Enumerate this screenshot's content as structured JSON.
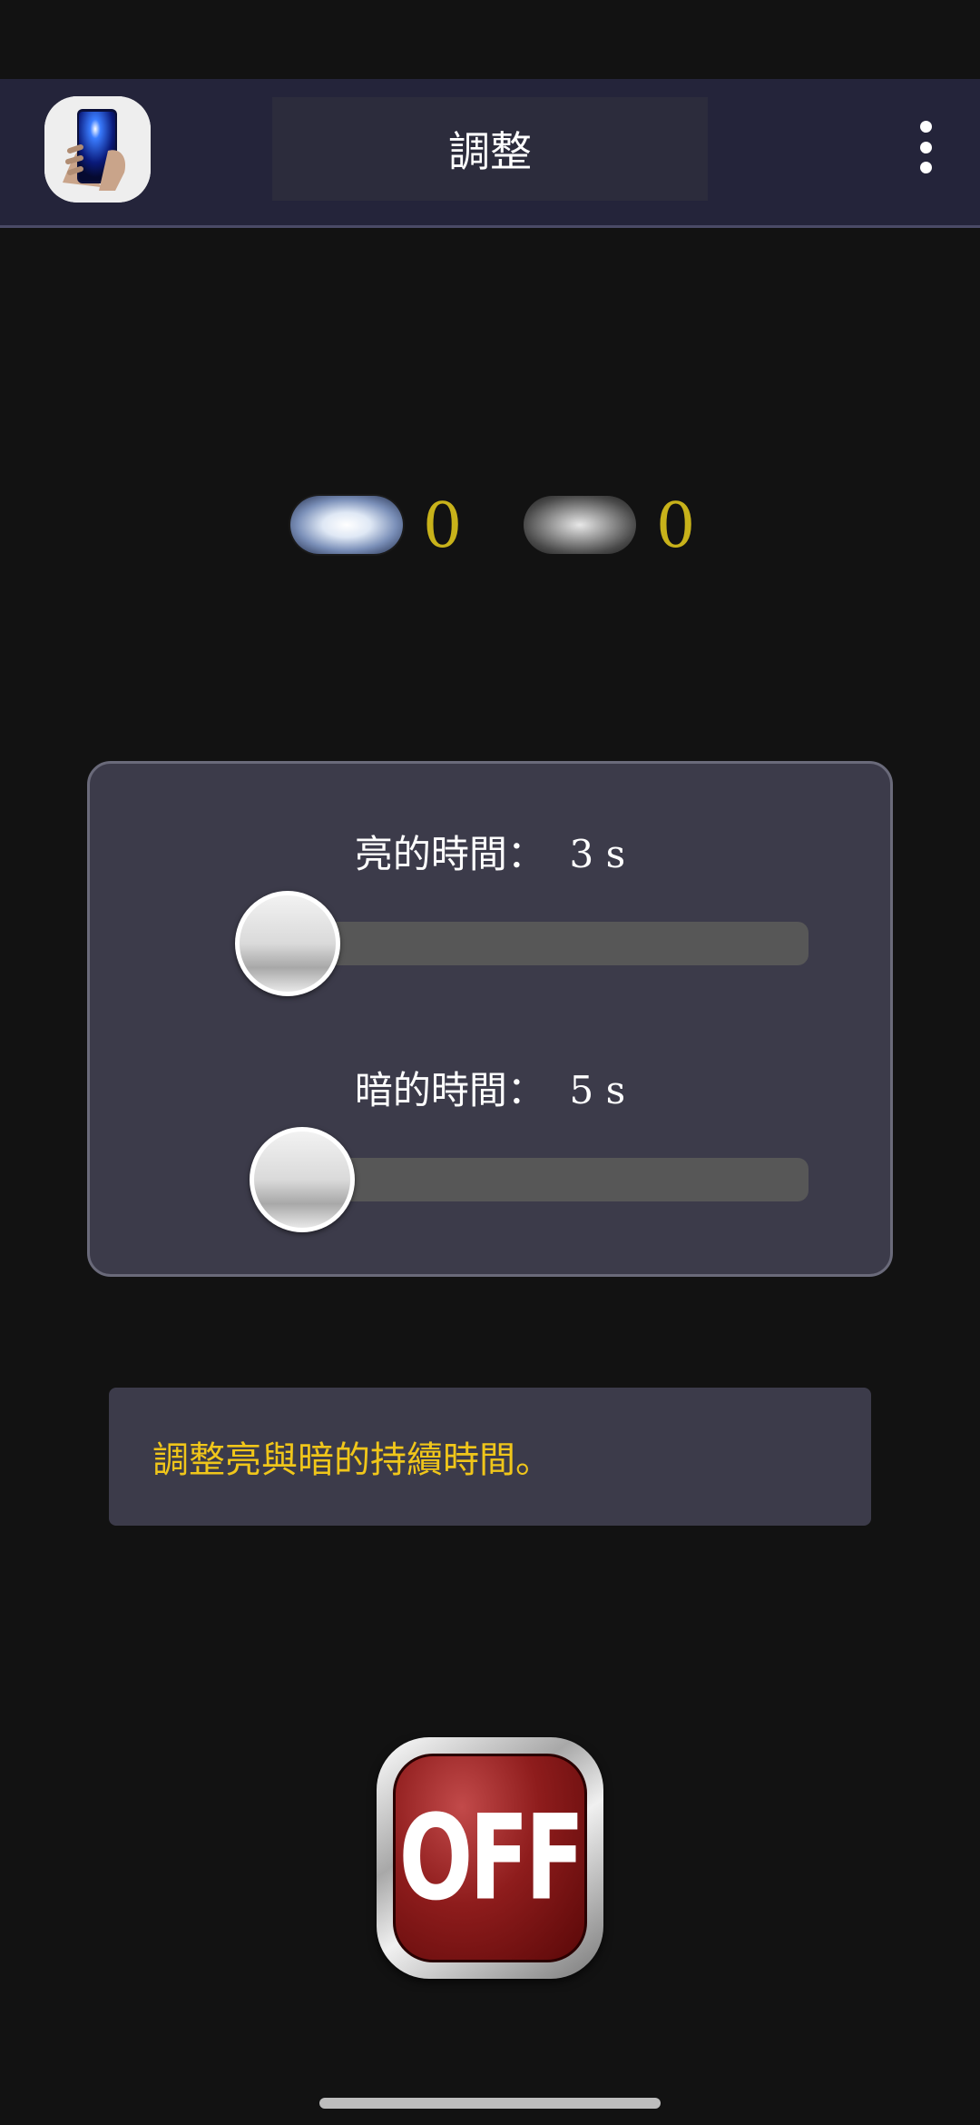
{
  "app_bar": {
    "title": "調整",
    "app_icon": "phone-flashlight-icon",
    "menu_icon": "more-vert-icon"
  },
  "counters": {
    "light_icon": "light-on-icon",
    "light_count": "0",
    "dark_icon": "light-off-icon",
    "dark_count": "0"
  },
  "sliders": {
    "bright": {
      "label": "亮的時間：  3 s",
      "value_seconds": 3
    },
    "dark": {
      "label": "暗的時間：  5 s",
      "value_seconds": 5
    }
  },
  "hint": "調整亮與暗的持續時間。",
  "power_button": {
    "label": "OFF",
    "icon": "power-off-button"
  },
  "colors": {
    "background": "#121212",
    "app_bar": "#24243a",
    "panel": "#3c3b4a",
    "counter_text": "#c8b21a",
    "hint_text": "#f0c61a",
    "button_red": "#8e1c1c"
  }
}
